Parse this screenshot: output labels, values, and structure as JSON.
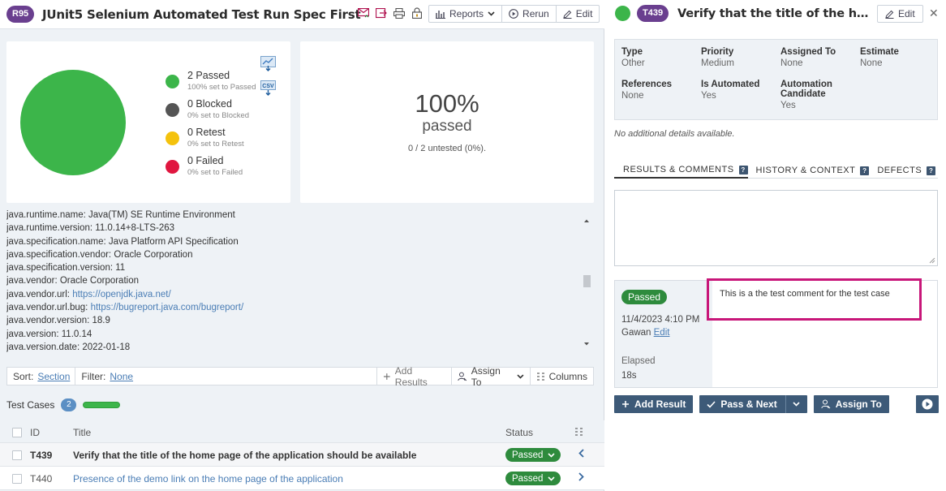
{
  "run": {
    "badge": "R95",
    "title": "JUnit5 Selenium Automated Test Run Spec First",
    "toolbar": {
      "reports": "Reports",
      "rerun": "Rerun",
      "edit": "Edit"
    },
    "icons": [
      "email-icon",
      "export-icon",
      "print-icon",
      "lock-icon"
    ]
  },
  "summary": {
    "legend": [
      {
        "label": "2 Passed",
        "sub": "100% set to Passed",
        "color": "#3cb54a"
      },
      {
        "label": "0 Blocked",
        "sub": "0% set to Blocked",
        "color": "#555555"
      },
      {
        "label": "0 Retest",
        "sub": "0% set to Retest",
        "color": "#f4c20d"
      },
      {
        "label": "0 Failed",
        "sub": "0% set to Failed",
        "color": "#e0163f"
      }
    ],
    "csv_label": "CSV",
    "percent": "100%",
    "percent_word": "passed",
    "untested": "0 / 2 untested (0%)."
  },
  "properties": [
    {
      "text": "java.runtime.name: Java(TM) SE Runtime Environment"
    },
    {
      "text": "java.runtime.version: 11.0.14+8-LTS-263"
    },
    {
      "text": "java.specification.name: Java Platform API Specification"
    },
    {
      "text": "java.specification.vendor: Oracle Corporation"
    },
    {
      "text": "java.specification.version: 11"
    },
    {
      "text": "java.vendor: Oracle Corporation"
    },
    {
      "key": "java.vendor.url: ",
      "link": "https://openjdk.java.net/"
    },
    {
      "key": "java.vendor.url.bug: ",
      "link": "https://bugreport.java.com/bugreport/"
    },
    {
      "text": "java.vendor.version: 18.9"
    },
    {
      "text": "java.version: 11.0.14"
    },
    {
      "text": "java.version.date: 2022-01-18"
    }
  ],
  "filter": {
    "sort_label": "Sort:",
    "sort_value": "Section",
    "filter_label": "Filter:",
    "filter_value": "None",
    "add_results": "Add Results",
    "assign_to": "Assign To",
    "columns": "Columns"
  },
  "test_cases": {
    "heading": "Test Cases",
    "count": "2",
    "columns": {
      "id": "ID",
      "title": "Title",
      "status": "Status"
    },
    "rows": [
      {
        "id": "T439",
        "title": "Verify that the title of the home page of the application should be available",
        "status": "Passed",
        "selected": true
      },
      {
        "id": "T440",
        "title": "Presence of the demo link on the home page of the application",
        "status": "Passed",
        "selected": false
      }
    ]
  },
  "detail": {
    "badge": "T439",
    "title": "Verify that the title of the home page of the application should be available",
    "edit": "Edit",
    "fields": [
      {
        "label": "Type",
        "value": "Other"
      },
      {
        "label": "Priority",
        "value": "Medium"
      },
      {
        "label": "Assigned To",
        "value": "None"
      },
      {
        "label": "Estimate",
        "value": "None"
      },
      {
        "label": "References",
        "value": "None"
      },
      {
        "label": "Is Automated",
        "value": "Yes"
      },
      {
        "label": "Automation\nCandidate",
        "value": "Yes"
      }
    ],
    "no_details": "No additional details available.",
    "tabs": [
      "RESULTS & COMMENTS",
      "HISTORY & CONTEXT",
      "DEFECTS"
    ],
    "result": {
      "status": "Passed",
      "date": "11/4/2023 4:10 PM",
      "user": "Gawan",
      "user_edit": "Edit",
      "elapsed_label": "Elapsed",
      "elapsed_value": "18s",
      "comment": "This is a the test comment for the test case"
    },
    "actions": {
      "add_result": "Add Result",
      "pass_next": "Pass & Next",
      "assign_to": "Assign To"
    }
  }
}
